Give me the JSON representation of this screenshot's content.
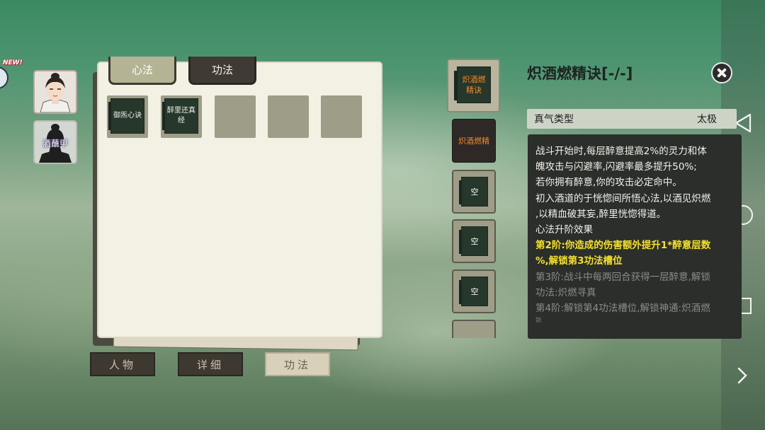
{
  "new_badge": "NEW!",
  "characters": [
    {
      "name": ""
    },
    {
      "name": "酒蘸甲"
    }
  ],
  "tabs": [
    {
      "label": "心法",
      "active": true
    },
    {
      "label": "功法",
      "active": false
    }
  ],
  "manual_slots": [
    {
      "title": "御炁心诀"
    },
    {
      "title": "醉里还真经"
    },
    {
      "title": ""
    },
    {
      "title": ""
    },
    {
      "title": ""
    }
  ],
  "bottom_buttons": [
    {
      "label": "人物",
      "active": false
    },
    {
      "label": "详细",
      "active": false
    },
    {
      "label": "功法",
      "active": true
    }
  ],
  "selected_book": {
    "title": "炽酒燃精诀",
    "title_color": "#f08a2a"
  },
  "technique_list": [
    {
      "title": "炽酒燃精",
      "active": true
    },
    {
      "title": "空"
    },
    {
      "title": "空"
    },
    {
      "title": "空"
    }
  ],
  "detail": {
    "title": "炽酒燃精诀[-/-]",
    "qi_label": "真气类型",
    "qi_value": "太极",
    "lines": [
      "战斗开始时,每层醉意提高2%的灵力和体",
      "魄攻击与闪避率,闪避率最多提升50%;",
      "若你拥有醉意,你的攻击必定命中。",
      "初入酒道的于恍惚间所悟心法,以酒见炽燃",
      ",以精血破其妄,醉里恍惚得道。",
      "心法升阶效果"
    ],
    "tier2": [
      "第2阶:你造成的伤害额外提升1*醉意层数",
      "%,解锁第3功法槽位"
    ],
    "tier3": [
      "第3阶:战斗中每两回合获得一层醉意,解锁",
      "功法:炽燃寻真"
    ],
    "tier4": [
      "第4阶:解锁第4功法槽位,解锁神通:炽酒燃"
    ],
    "tail": "剑"
  },
  "colors": {
    "highlight_yellow": "#f4e030",
    "book_green": "#26372c",
    "panel_cream": "#f3f0e4",
    "orange": "#f08a2a"
  },
  "icons": [
    "close-icon",
    "back-triangle-icon",
    "home-circle-icon",
    "recent-square-icon",
    "chevron-right-icon",
    "new-mascot-icon"
  ]
}
